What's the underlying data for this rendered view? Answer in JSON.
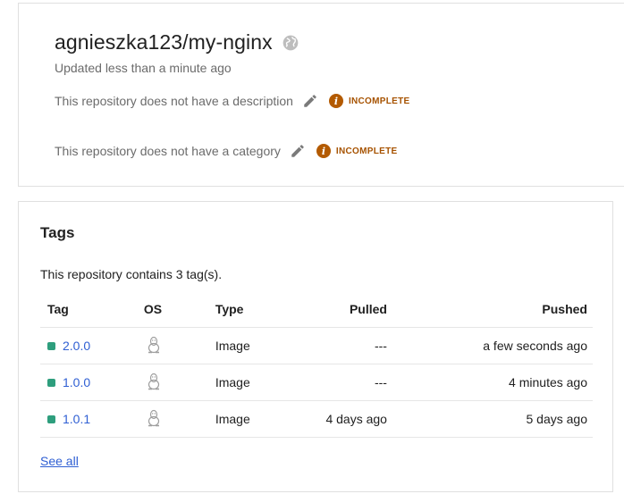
{
  "repo": {
    "title": "agnieszka123/my-nginx",
    "updated": "Updated less than a minute ago",
    "description_text": "This repository does not have a description",
    "category_text": "This repository does not have a category",
    "incomplete_badge": "INCOMPLETE"
  },
  "tags": {
    "heading": "Tags",
    "summary": "This repository contains 3 tag(s).",
    "columns": {
      "tag": "Tag",
      "os": "OS",
      "type": "Type",
      "pulled": "Pulled",
      "pushed": "Pushed"
    },
    "rows": [
      {
        "tag": "2.0.0",
        "os": "linux-icon",
        "type": "Image",
        "pulled": "---",
        "pushed": "a few seconds ago"
      },
      {
        "tag": "1.0.0",
        "os": "linux-icon",
        "type": "Image",
        "pulled": "---",
        "pushed": "4 minutes ago"
      },
      {
        "tag": "1.0.1",
        "os": "linux-icon",
        "type": "Image",
        "pulled": "4 days ago",
        "pushed": "5 days ago"
      }
    ],
    "see_all": "See all"
  },
  "colors": {
    "link": "#2f5fd3",
    "status_dot": "#2e9e7d",
    "incomplete": "#b35a00"
  }
}
